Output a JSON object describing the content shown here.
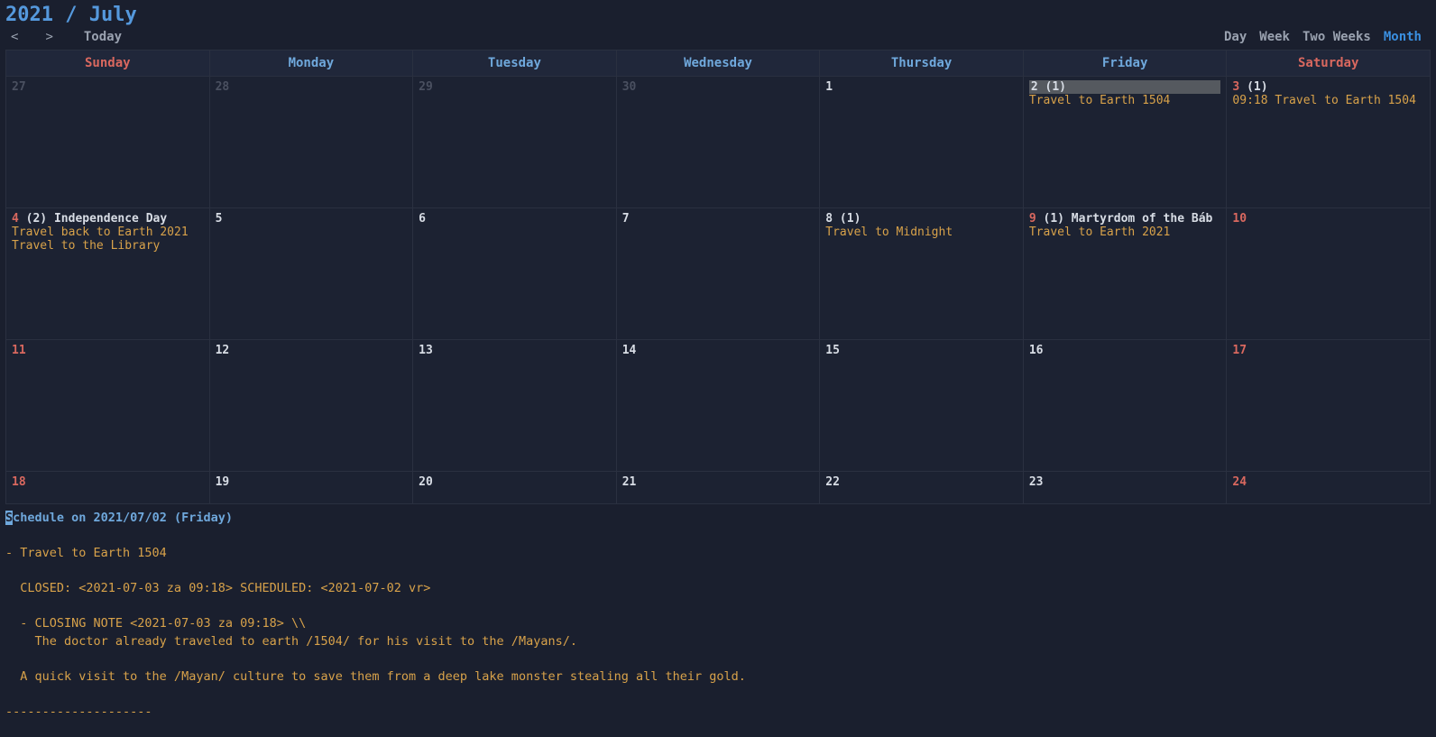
{
  "header": {
    "title": "2021 / July",
    "prev": "<",
    "next": ">",
    "today": "Today"
  },
  "views": {
    "day": "Day",
    "week": "Week",
    "two_weeks": "Two Weeks",
    "month": "Month",
    "active": "month"
  },
  "weekdays": [
    "Sunday",
    "Monday",
    "Tuesday",
    "Wednesday",
    "Thursday",
    "Friday",
    "Saturday"
  ],
  "grid": [
    [
      {
        "n": "27",
        "other": true
      },
      {
        "n": "28",
        "other": true
      },
      {
        "n": "29",
        "other": true
      },
      {
        "n": "30",
        "other": true
      },
      {
        "n": "1"
      },
      {
        "n": "2",
        "count": "(1)",
        "selected": true,
        "events": [
          "Travel to Earth 1504"
        ]
      },
      {
        "n": "3",
        "weekend": true,
        "count": "(1)",
        "events": [
          "09:18 Travel to Earth 1504"
        ]
      }
    ],
    [
      {
        "n": "4",
        "weekend": true,
        "count": "(2)",
        "holiday": "Independence Day",
        "events": [
          "Travel back to Earth 2021",
          "Travel to the Library"
        ]
      },
      {
        "n": "5"
      },
      {
        "n": "6"
      },
      {
        "n": "7"
      },
      {
        "n": "8",
        "count": "(1)",
        "events": [
          "Travel to Midnight"
        ]
      },
      {
        "n": "9",
        "weekend": true,
        "count": "(1)",
        "holiday": "Martyrdom of the Báb",
        "events": [
          "Travel to Earth 2021"
        ]
      },
      {
        "n": "10",
        "weekend": true
      }
    ],
    [
      {
        "n": "11",
        "weekend": true
      },
      {
        "n": "12"
      },
      {
        "n": "13"
      },
      {
        "n": "14"
      },
      {
        "n": "15"
      },
      {
        "n": "16"
      },
      {
        "n": "17",
        "weekend": true
      }
    ],
    [
      {
        "n": "18",
        "weekend": true
      },
      {
        "n": "19"
      },
      {
        "n": "20"
      },
      {
        "n": "21"
      },
      {
        "n": "22"
      },
      {
        "n": "23"
      },
      {
        "n": "24",
        "weekend": true
      }
    ]
  ],
  "detail": {
    "title_prefix": "S",
    "title_rest": "chedule on 2021/07/02 (Friday)",
    "lines": [
      "- Travel to Earth 1504",
      "",
      "  CLOSED: <2021-07-03 za 09:18> SCHEDULED: <2021-07-02 vr>",
      "",
      "  - CLOSING NOTE <2021-07-03 za 09:18> \\\\",
      "    The doctor already traveled to earth /1504/ for his visit to the /Mayans/.",
      "",
      "  A quick visit to the /Mayan/ culture to save them from a deep lake monster stealing all their gold.",
      "",
      "--------------------"
    ]
  }
}
